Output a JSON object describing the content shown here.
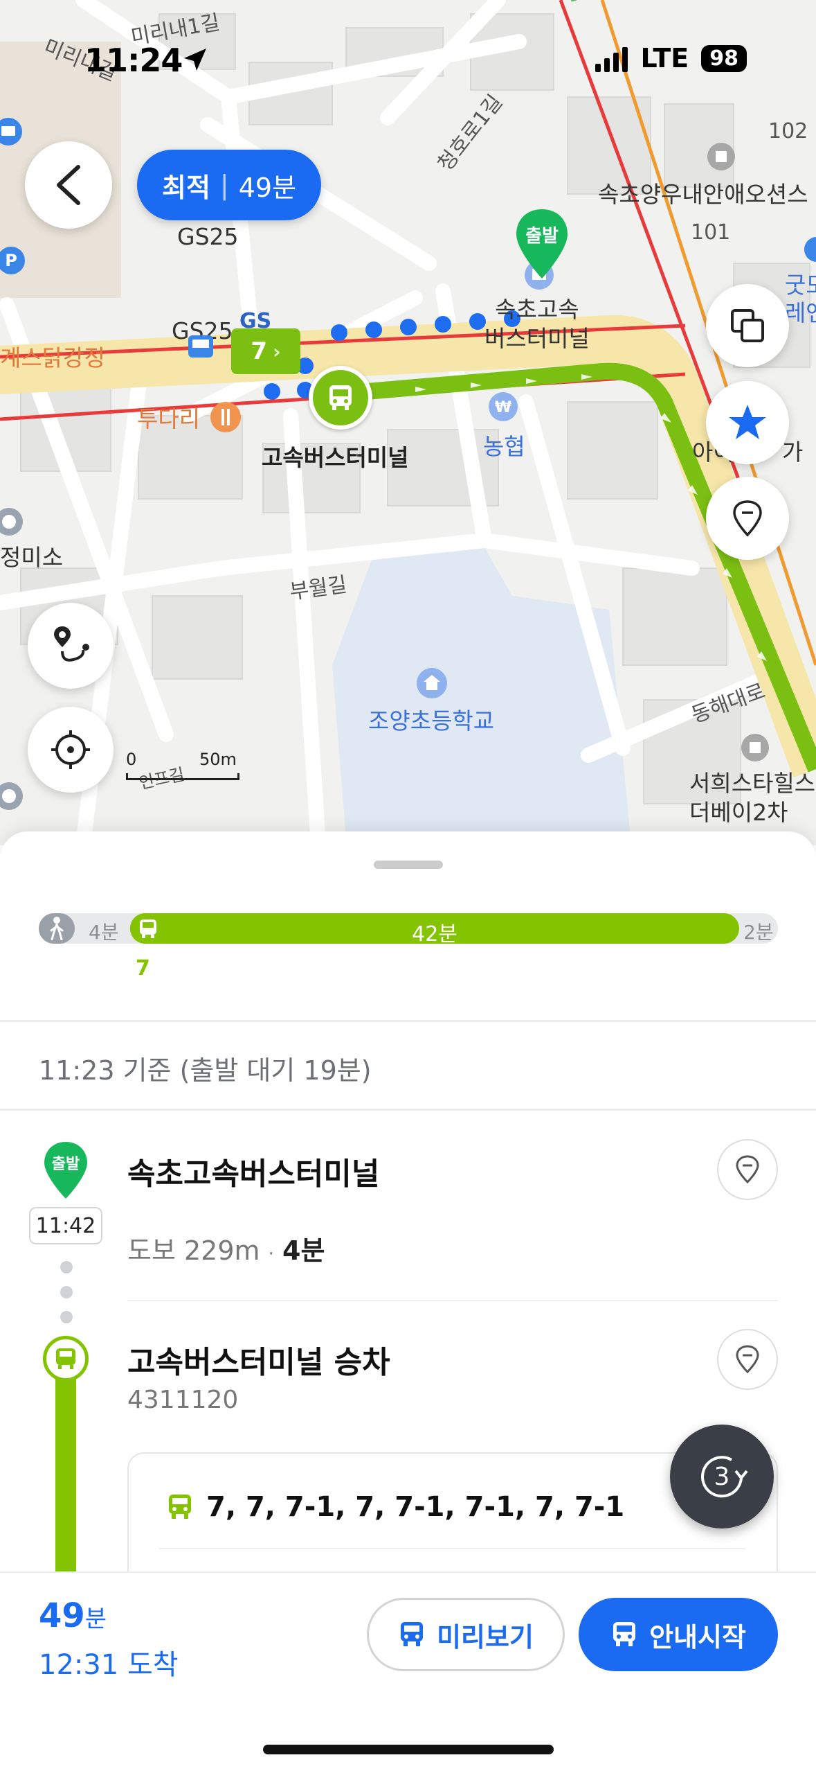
{
  "status": {
    "time": "11:24",
    "network": "LTE",
    "battery": "98"
  },
  "map": {
    "labels": {
      "street1": "미리내1길",
      "street2": "미리내길",
      "street3": "청호로1길",
      "gs25a": "GS25",
      "gs25b": "GS25",
      "gs": "GS",
      "chicken": "계스닭강정",
      "dudari": "투다리",
      "nh": "농협",
      "terminal_poi": "속초고속\n버스터미널",
      "terminal_stop": "고속버스터미널",
      "apt1": "속초양우내안애오션스",
      "n102": "102",
      "n101": "101",
      "good": "굿모\n레앤",
      "ayi": "아이",
      "ga": "가",
      "jeongmi": "정미소",
      "buwol": "부월길",
      "school": "조양초등학교",
      "donghae": "동해대로",
      "seohee": "서희스타힐스\n더베이2차",
      "ingi": "인프길"
    },
    "start_marker": "출발",
    "bus_tag": "7",
    "scale": {
      "zero": "0",
      "dist": "50m"
    }
  },
  "route_pill": {
    "label": "최적",
    "duration": "49분"
  },
  "timeline": {
    "walk_start": "4분",
    "bus_time": "42분",
    "walk_end": "2분",
    "bus_number": "7"
  },
  "basis": "11:23 기준 (출발 대기 19분)",
  "steps": {
    "start": {
      "marker": "출발",
      "time": "11:42",
      "title": "속초고속버스터미널",
      "walk_prefix": "도보 229m",
      "walk_sep": "·",
      "walk_time": "4분"
    },
    "board": {
      "title": "고속버스터미널 승차",
      "stop_id": "4311120",
      "buses": "7, 7, 7-1, 7, 7-1, 7-1, 7, 7-1"
    }
  },
  "refresh_count": "3",
  "bottom": {
    "eta_min": "49",
    "eta_unit": "분",
    "arrival": "12:31 도착",
    "preview_label": "미리보기",
    "start_label": "안내시작"
  },
  "colors": {
    "accent": "#1a6af2",
    "bus_green": "#83c300",
    "walk_gray": "#9aa0a8"
  }
}
